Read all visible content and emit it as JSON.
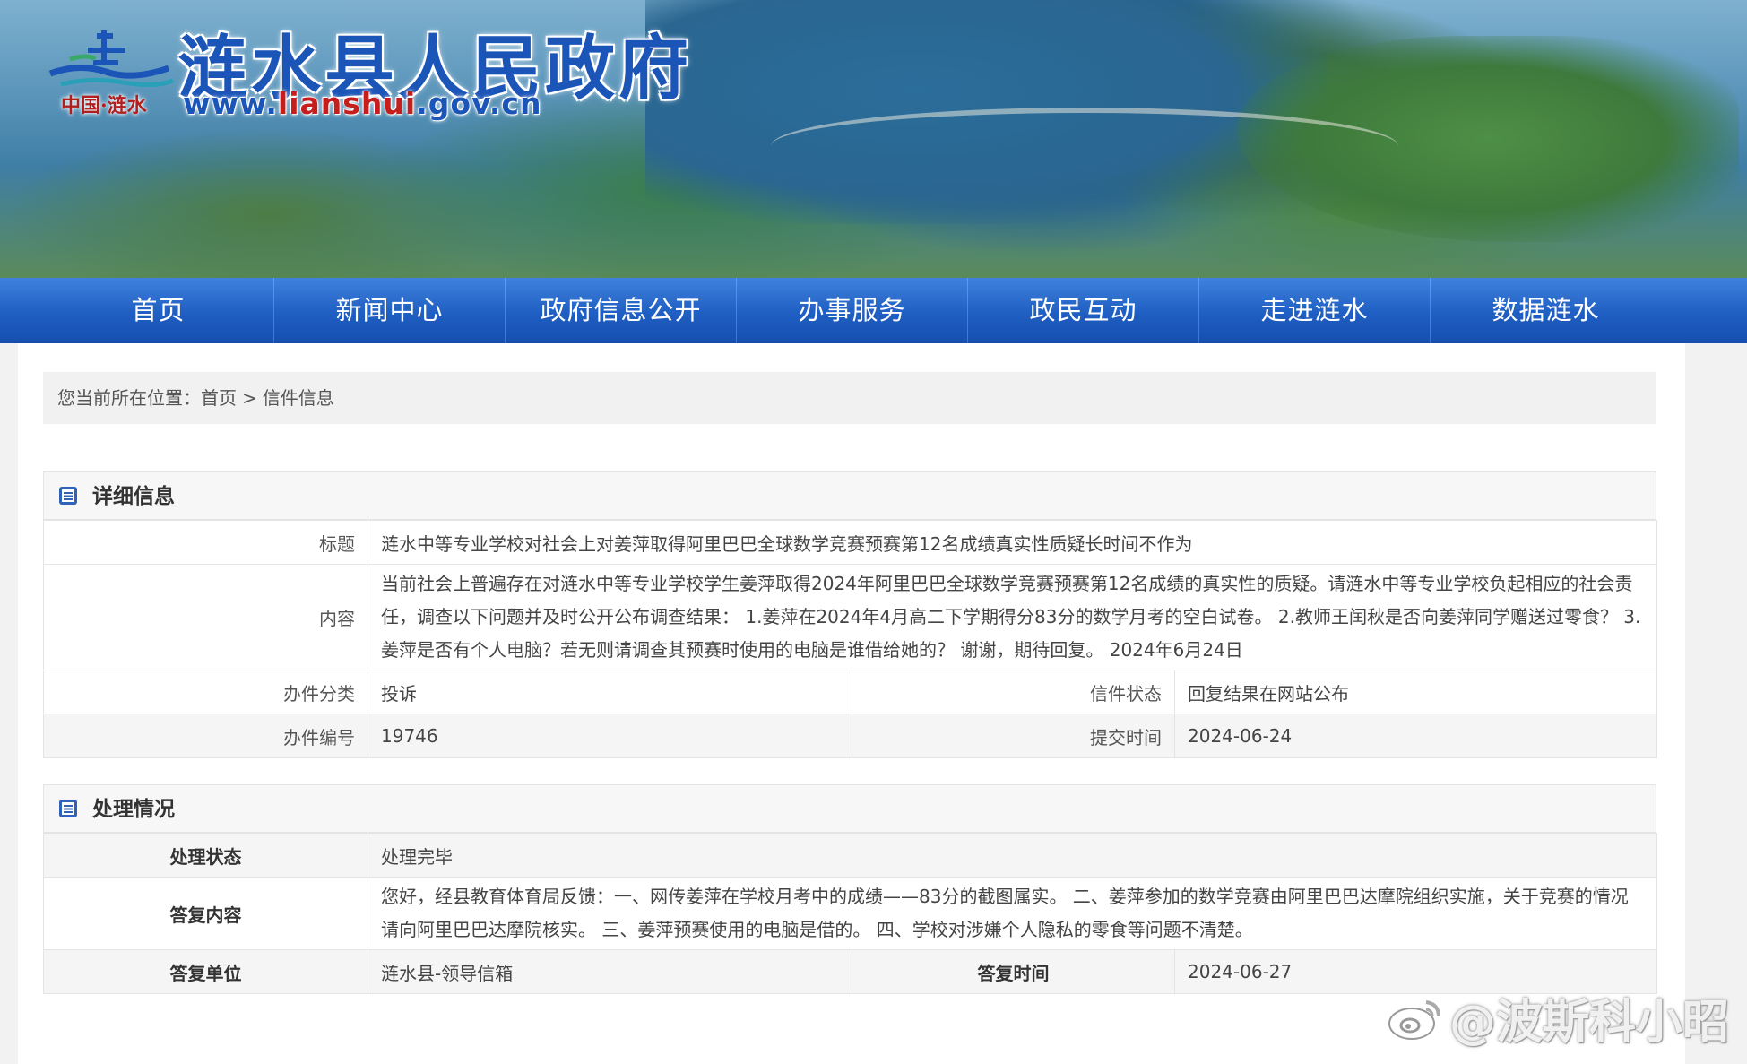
{
  "header": {
    "site_title": "涟水县人民政府",
    "logo_sub": "中国·涟水",
    "url_prefix": "www.",
    "url_highlight": "lianshui",
    "url_suffix": ".gov.cn"
  },
  "nav": {
    "items": [
      "首页",
      "新闻中心",
      "政府信息公开",
      "办事服务",
      "政民互动",
      "走进涟水",
      "数据涟水"
    ]
  },
  "breadcrumb": {
    "prefix": "您当前所在位置：",
    "home": "首页",
    "separator": ">",
    "current": "信件信息"
  },
  "detail": {
    "heading": "详细信息",
    "title_label": "标题",
    "title_value": "涟水中等专业学校对社会上对姜萍取得阿里巴巴全球数学竞赛预赛第12名成绩真实性质疑长时间不作为",
    "content_label": "内容",
    "content_value": "当前社会上普遍存在对涟水中等专业学校学生姜萍取得2024年阿里巴巴全球数学竞赛预赛第12名成绩的真实性的质疑。请涟水中等专业学校负起相应的社会责任，调查以下问题并及时公开公布调查结果： 1.姜萍在2024年4月高二下学期得分83分的数学月考的空白试卷。 2.教师王闰秋是否向姜萍同学赠送过零食？ 3.姜萍是否有个人电脑？若无则请调查其预赛时使用的电脑是谁借给她的？ 谢谢，期待回复。 2024年6月24日",
    "category_label": "办件分类",
    "category_value": "投诉",
    "status_label": "信件状态",
    "status_value": "回复结果在网站公布",
    "number_label": "办件编号",
    "number_value": "19746",
    "submit_time_label": "提交时间",
    "submit_time_value": "2024-06-24"
  },
  "processing": {
    "heading": "处理情况",
    "state_label": "处理状态",
    "state_value": "处理完毕",
    "reply_label": "答复内容",
    "reply_value": "您好，经县教育体育局反馈：一、网传姜萍在学校月考中的成绩——83分的截图属实。 二、姜萍参加的数学竞赛由阿里巴巴达摩院组织实施，关于竞赛的情况请向阿里巴巴达摩院核实。 三、姜萍预赛使用的电脑是借的。 四、学校对涉嫌个人隐私的零食等问题不清楚。",
    "unit_label": "答复单位",
    "unit_value": "涟水县-领导信箱",
    "reply_time_label": "答复时间",
    "reply_time_value": "2024-06-27"
  },
  "watermark": {
    "text": "@波斯科小昭"
  },
  "icons": {
    "section_icon": "document-list-icon",
    "watermark_icon": "weibo-icon"
  },
  "colors": {
    "nav_blue": "#1f5ec2",
    "title_blue": "#1b55b8",
    "url_red": "#c61d1d"
  }
}
